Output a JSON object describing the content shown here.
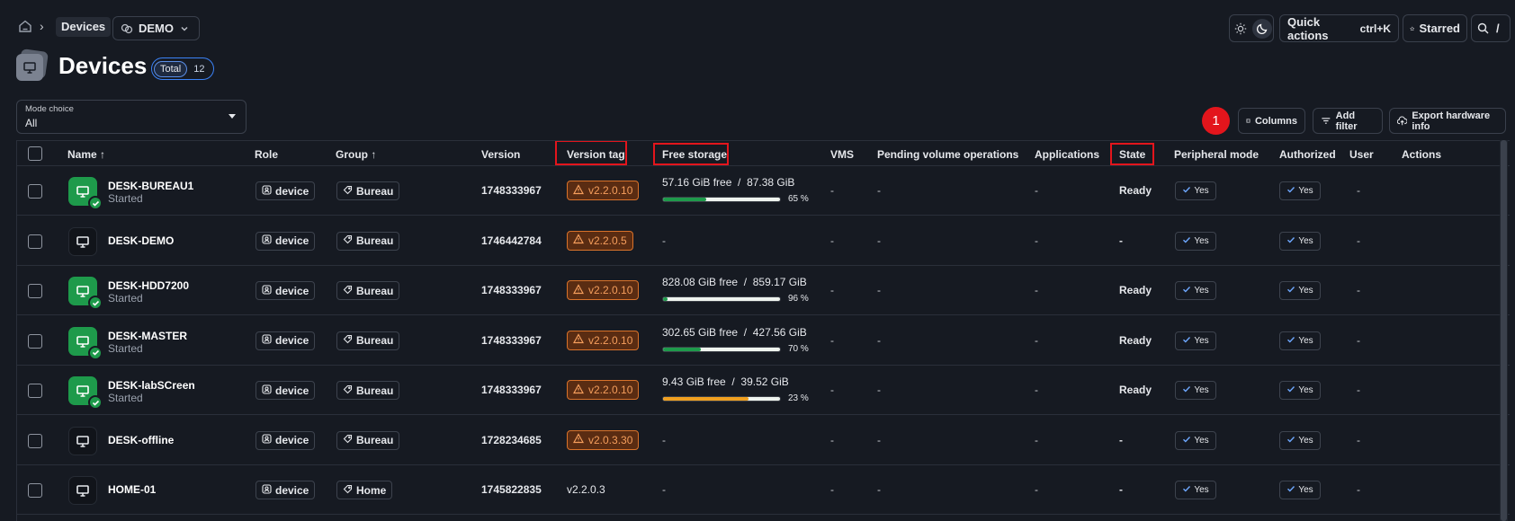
{
  "breadcrumb": {
    "current": "Devices"
  },
  "org": {
    "label": "DEMO"
  },
  "header": {
    "quick_actions": "Quick actions",
    "shortcut": "ctrl+K",
    "starred": "Starred",
    "search_shortcut": "/"
  },
  "page": {
    "title": "Devices",
    "total_label": "Total",
    "total_count": "12"
  },
  "filter": {
    "label": "Mode choice",
    "value": "All"
  },
  "toolbar": {
    "marker": "1",
    "columns": "Columns",
    "add_filter": "Add filter",
    "export": "Export hardware info"
  },
  "columns": {
    "name": "Name",
    "role": "Role",
    "group": "Group",
    "version": "Version",
    "version_tag": "Version tag",
    "free_storage": "Free storage",
    "vms": "VMS",
    "pending": "Pending volume operations",
    "applications": "Applications",
    "state": "State",
    "peripheral": "Peripheral mode",
    "authorized": "Authorized",
    "user": "User",
    "actions": "Actions"
  },
  "rows": [
    {
      "name": "DESK-BUREAU1",
      "status": "Started",
      "role": "device",
      "group": "Bureau",
      "version": "1748333967",
      "version_tag": "v2.2.0.10",
      "tag_warning": true,
      "storage_free": "57.16 GiB free",
      "storage_total": "87.38 GiB",
      "storage_pct": 65,
      "storage_pct_label": "65 %",
      "vms": "-",
      "pending": "-",
      "applications": "-",
      "state": "Ready",
      "peripheral": "Yes",
      "authorized": "Yes",
      "user": "-"
    },
    {
      "name": "DESK-DEMO",
      "status": "",
      "role": "device",
      "group": "Bureau",
      "version": "1746442784",
      "version_tag": "v2.2.0.5",
      "tag_warning": true,
      "storage_free": "-",
      "vms": "-",
      "pending": "-",
      "applications": "-",
      "state": "-",
      "peripheral": "Yes",
      "authorized": "Yes",
      "user": "-"
    },
    {
      "name": "DESK-HDD7200",
      "status": "Started",
      "role": "device",
      "group": "Bureau",
      "version": "1748333967",
      "version_tag": "v2.2.0.10",
      "tag_warning": true,
      "storage_free": "828.08 GiB free",
      "storage_total": "859.17 GiB",
      "storage_pct": 96,
      "storage_pct_label": "96 %",
      "vms": "-",
      "pending": "-",
      "applications": "-",
      "state": "Ready",
      "peripheral": "Yes",
      "authorized": "Yes",
      "user": "-"
    },
    {
      "name": "DESK-MASTER",
      "status": "Started",
      "role": "device",
      "group": "Bureau",
      "version": "1748333967",
      "version_tag": "v2.2.0.10",
      "tag_warning": true,
      "storage_free": "302.65 GiB free",
      "storage_total": "427.56 GiB",
      "storage_pct": 70,
      "storage_pct_label": "70 %",
      "vms": "-",
      "pending": "-",
      "applications": "-",
      "state": "Ready",
      "peripheral": "Yes",
      "authorized": "Yes",
      "user": "-"
    },
    {
      "name": "DESK-labSCreen",
      "status": "Started",
      "role": "device",
      "group": "Bureau",
      "version": "1748333967",
      "version_tag": "v2.2.0.10",
      "tag_warning": true,
      "storage_free": "9.43 GiB free",
      "storage_total": "39.52 GiB",
      "storage_pct": 23,
      "storage_pct_label": "23 %",
      "vms": "-",
      "pending": "-",
      "applications": "-",
      "state": "Ready",
      "peripheral": "Yes",
      "authorized": "Yes",
      "user": "-"
    },
    {
      "name": "DESK-offline",
      "status": "",
      "role": "device",
      "group": "Bureau",
      "version": "1728234685",
      "version_tag": "v2.0.3.30",
      "tag_warning": true,
      "storage_free": "-",
      "vms": "-",
      "pending": "-",
      "applications": "-",
      "state": "-",
      "peripheral": "Yes",
      "authorized": "Yes",
      "user": "-"
    },
    {
      "name": "HOME-01",
      "status": "",
      "role": "device",
      "group": "Home",
      "version": "1745822835",
      "version_tag": "v2.2.0.3",
      "tag_warning": false,
      "storage_free": "-",
      "vms": "-",
      "pending": "-",
      "applications": "-",
      "state": "-",
      "peripheral": "Yes",
      "authorized": "Yes",
      "user": "-"
    }
  ],
  "colors": {
    "accent": "#3b82f6",
    "success": "#1e9a4b",
    "warning": "#d9722a",
    "highlight": "#e3151c"
  }
}
